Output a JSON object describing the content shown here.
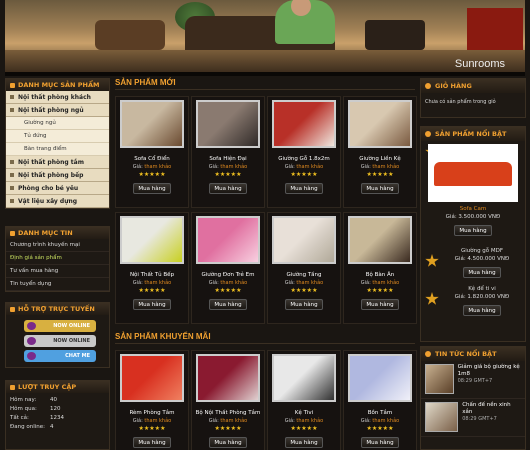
{
  "banner": {
    "title": "Sunrooms"
  },
  "left": {
    "categories_title": "DANH MỤC SẢN PHẨM",
    "categories": [
      {
        "label": "Nội thất phòng khách",
        "type": "cat"
      },
      {
        "label": "Nội thất phòng ngủ",
        "type": "cat"
      },
      {
        "label": "Giường ngủ",
        "type": "sub"
      },
      {
        "label": "Tủ đứng",
        "type": "sub"
      },
      {
        "label": "Bàn trang điểm",
        "type": "sub"
      },
      {
        "label": "Nội thất phòng tắm",
        "type": "cat"
      },
      {
        "label": "Nội thất phòng bếp",
        "type": "cat"
      },
      {
        "label": "Phòng cho bé yêu",
        "type": "cat"
      },
      {
        "label": "Vật liệu xây dựng",
        "type": "cat"
      }
    ],
    "news_title": "DANH MỤC TIN",
    "news": [
      "Chương trình khuyến mại",
      "Định giá sản phẩm",
      "Tư vấn mua hàng",
      "Tin tuyển dụng"
    ],
    "support_title": "HỖ TRỢ TRỰC TUYẾN",
    "support": [
      {
        "label": "NOW ONLINE",
        "color": "#d8b040"
      },
      {
        "label": "NOW ONLINE",
        "color": "#c8c8c8"
      },
      {
        "label": "CHAT ME",
        "color": "#50a0e0"
      }
    ],
    "stats_title": "LƯỢT TRUY CẬP",
    "stats": [
      {
        "k": "Hôm nay:",
        "v": "40"
      },
      {
        "k": "Hôm qua:",
        "v": "120"
      },
      {
        "k": "Tất cả:",
        "v": "1234"
      },
      {
        "k": "Đang online:",
        "v": "4"
      }
    ]
  },
  "main": {
    "new_title": "SẢN PHẨM MỚI",
    "promo_title": "SẢN PHẨM KHUYẾN MÃI",
    "price_label": "Giá:",
    "price_value": "tham khảo",
    "stars": "★★★★★",
    "buy": "Mua hàng",
    "new_products": [
      {
        "name": "Sofa Cổ Điển",
        "c1": "#c8b8a0",
        "c2": "#6a4a30"
      },
      {
        "name": "Sofa Hiện Đại",
        "c1": "#8a7a70",
        "c2": "#302a28"
      },
      {
        "name": "Giường Gỗ 1.8x2m",
        "c1": "#b83028",
        "c2": "#f0e8e0"
      },
      {
        "name": "Giường Liền Kệ",
        "c1": "#d8c8b0",
        "c2": "#7a5a40"
      },
      {
        "name": "Nội Thất Tủ Bếp",
        "c1": "#e8e8e0",
        "c2": "#c8d020"
      },
      {
        "name": "Giường Đơn Trẻ Em",
        "c1": "#e070a0",
        "c2": "#f8d0e0"
      },
      {
        "name": "Giường Tầng",
        "c1": "#e8e0d8",
        "c2": "#b0a898"
      },
      {
        "name": "Bộ Bàn Ăn",
        "c1": "#c8b898",
        "c2": "#3a2a20"
      }
    ],
    "promo_products": [
      {
        "name": "Rèm Phòng Tắm",
        "c1": "#d83020",
        "c2": "#f08060"
      },
      {
        "name": "Bộ Nội Thất Phòng Tắm",
        "c1": "#8a1a30",
        "c2": "#e0d0d0"
      },
      {
        "name": "Kệ Tivi",
        "c1": "#e8e8e8",
        "c2": "#303030"
      },
      {
        "name": "Bồn Tắm",
        "c1": "#b0b8e0",
        "c2": "#f0f0f8"
      }
    ]
  },
  "right": {
    "cart_title": "GIỎ HÀNG",
    "cart_text": "Chưa có sản phẩm trong giỏ",
    "featured_title": "SẢN PHẨM NỔI BẬT",
    "featured": [
      {
        "rank": "01",
        "name": "Sofa Cam",
        "price": "Giá: 3.500.000 VNĐ"
      },
      {
        "rank": "",
        "name": "Giường gỗ MDF",
        "price": "Giá: 4.500.000 VNĐ"
      },
      {
        "rank": "",
        "name": "Kệ để ti vi",
        "price": "Giá: 1.820.000 VNĐ"
      }
    ],
    "buy": "Mua hàng",
    "news_title": "TIN TỨC NỔI BẬT",
    "news": [
      {
        "title": "Giảm giá bộ giường kệ 1m8",
        "date": "08:29 GMT+7"
      },
      {
        "title": "Chấn đế nền xinh xắn",
        "date": "08:29 GMT+7"
      }
    ]
  }
}
